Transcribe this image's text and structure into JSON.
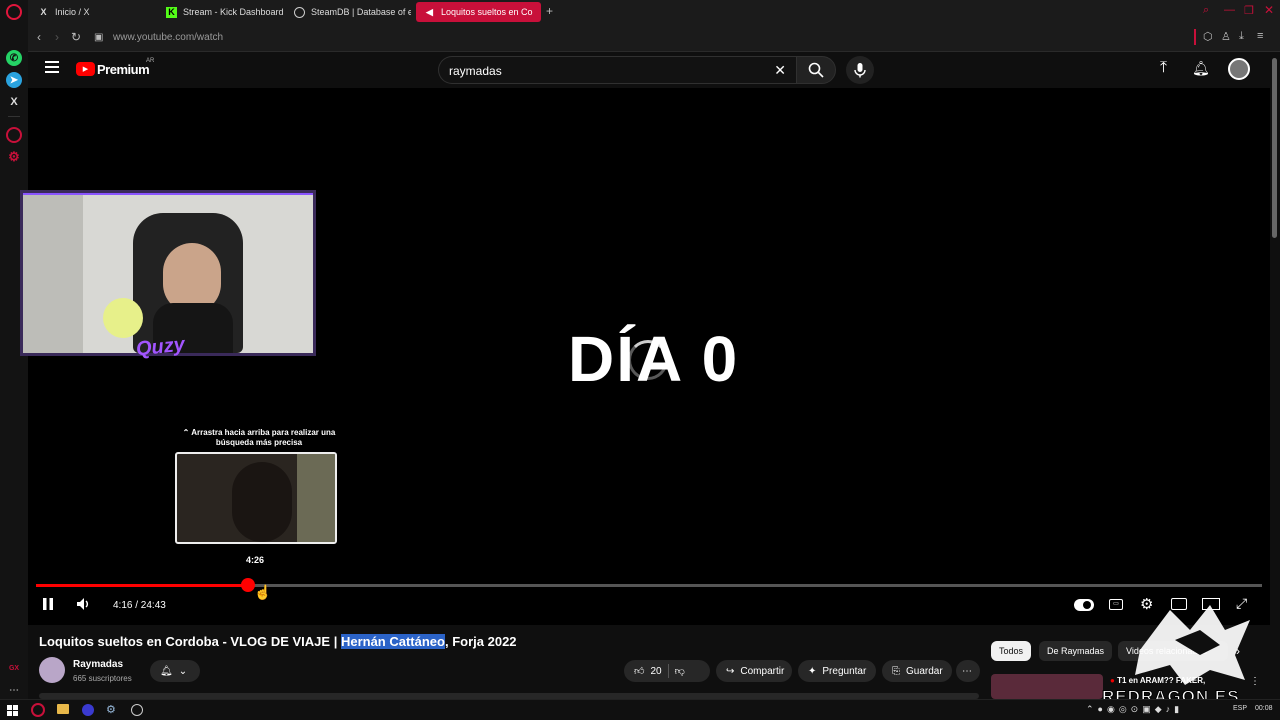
{
  "browser": {
    "tabs": [
      {
        "label": "Inicio / X",
        "icon": "x-icon",
        "active": false
      },
      {
        "label": "Stream - Kick Dashboard",
        "icon": "kick-icon",
        "active": false
      },
      {
        "label": "SteamDB | Database of ev",
        "icon": "steam-icon",
        "active": false
      },
      {
        "label": "Loquitos sueltos en Co",
        "icon": "speaker-icon",
        "active": true
      }
    ],
    "new_tab": "+",
    "url": "www.youtube.com/watch"
  },
  "youtube": {
    "logo_text": "Premium",
    "logo_region": "AR",
    "search_value": "raymadas"
  },
  "player": {
    "overlay_title": "DÍA 0",
    "webcam_logo": "Quzy",
    "drag_hint": "Arrastra hacia arriba para realizar una búsqueda más precisa",
    "preview_time": "4:26",
    "time_display": "4:16 / 24:43",
    "progress_fraction": 0.173,
    "accent": "#ff0000"
  },
  "video": {
    "title_before": "Loquitos sueltos en Cordoba - VLOG DE VIAJE | ",
    "title_highlight": "Hernán Cattáneo",
    "title_after": ", Forja 2022",
    "channel_name": "Raymadas",
    "subscribers": "665 suscriptores",
    "likes": "20",
    "share_label": "Compartir",
    "ask_label": "Preguntar",
    "save_label": "Guardar"
  },
  "recommendations": {
    "chips": [
      "Todos",
      "De Raymadas",
      "Videos relacionados"
    ],
    "first_title": "T1 en ARAM?? FAKER,"
  },
  "watermark": "REDRAGON.ES",
  "taskbar": {
    "lang": "ESP",
    "clock": "00:08"
  }
}
